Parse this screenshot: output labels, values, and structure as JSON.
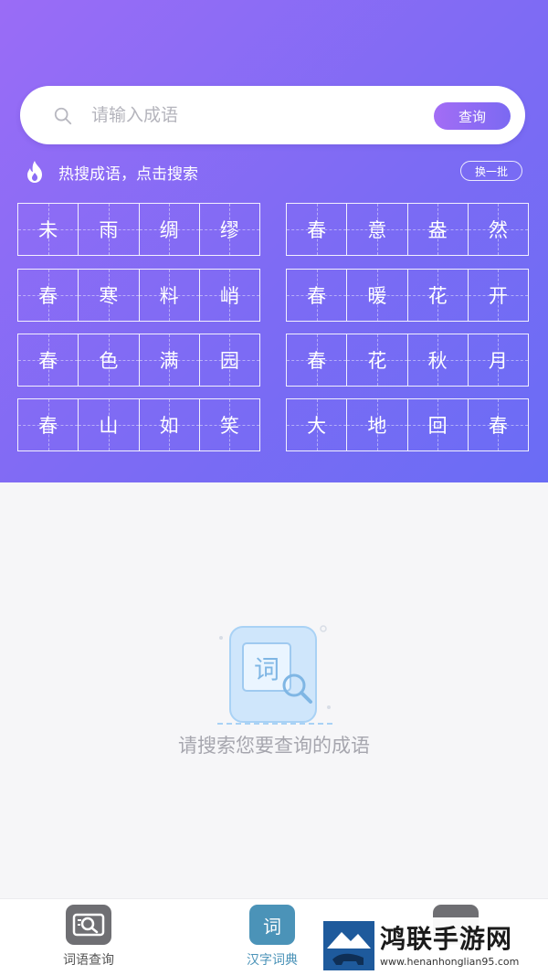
{
  "search": {
    "placeholder": "请输入成语",
    "button_label": "查询"
  },
  "hot": {
    "title": "热搜成语，点击搜索",
    "refresh_label": "换一批",
    "idioms": [
      [
        "未",
        "雨",
        "绸",
        "缪"
      ],
      [
        "春",
        "意",
        "盎",
        "然"
      ],
      [
        "春",
        "寒",
        "料",
        "峭"
      ],
      [
        "春",
        "暖",
        "花",
        "开"
      ],
      [
        "春",
        "色",
        "满",
        "园"
      ],
      [
        "春",
        "花",
        "秋",
        "月"
      ],
      [
        "春",
        "山",
        "如",
        "笑"
      ],
      [
        "大",
        "地",
        "回",
        "春"
      ]
    ]
  },
  "empty_state": {
    "illustration_char": "词",
    "message": "请搜索您要查询的成语"
  },
  "tabbar": {
    "tabs": [
      {
        "label": "词语查询",
        "icon": "magnifier-card-icon",
        "active": false
      },
      {
        "label": "汉字词典",
        "icon": "dictionary-icon",
        "icon_char": "词",
        "active": true
      },
      {
        "label": "",
        "icon": "more-icon",
        "active": false
      }
    ]
  },
  "watermark": {
    "name": "鸿联手游网",
    "url": "www.henanhonglian95.com"
  },
  "colors": {
    "hero_start": "#9a6cf6",
    "hero_end": "#6a6cf5",
    "active_tab": "#4b93b8"
  }
}
